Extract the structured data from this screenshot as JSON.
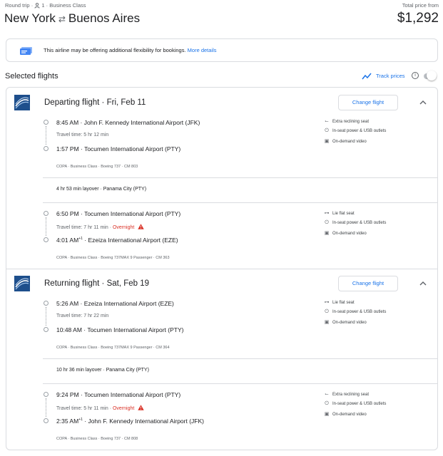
{
  "header": {
    "trip_type": "Round trip",
    "passengers": "1",
    "cabin": "Business Class",
    "origin": "New York",
    "destination": "Buenos Aires",
    "price_label": "Total price from",
    "price": "$1,292"
  },
  "banner": {
    "icon": "ticket-icon",
    "text": "This airline may be offering additional flexibility for bookings.",
    "link": "More details"
  },
  "selected": {
    "title": "Selected flights",
    "track_prices": "Track prices",
    "track_enabled": false
  },
  "departing": {
    "title": "Departing flight",
    "date": "Fri, Feb 11",
    "change": "Change flight",
    "segments": [
      {
        "dep_time": "8:45 AM",
        "dep_airport": "John F. Kennedy International Airport (JFK)",
        "travel": "Travel time: 5 hr 12 min",
        "overnight": "",
        "arr_time": "1:57 PM",
        "arr_sup": "",
        "arr_airport": "Tocumen International Airport (PTY)",
        "details": "COPA · Business Class · Boeing 737 · CM 803",
        "amenities": [
          "Extra reclining seat",
          "In-seat power & USB outlets",
          "On-demand video"
        ]
      },
      {
        "dep_time": "6:50 PM",
        "dep_airport": "Tocumen International Airport (PTY)",
        "travel": "Travel time: 7 hr 11 min",
        "overnight": "Overnight",
        "arr_time": "4:01 AM",
        "arr_sup": "+1",
        "arr_airport": "Ezeiza International Airport (EZE)",
        "details": "COPA · Business Class · Boeing 737MAX 9 Passenger · CM 363",
        "amenities": [
          "Lie flat seat",
          "In-seat power & USB outlets",
          "On-demand video"
        ]
      }
    ],
    "layover": "4 hr 53 min layover · Panama City (PTY)"
  },
  "returning": {
    "title": "Returning flight",
    "date": "Sat, Feb 19",
    "change": "Change flight",
    "segments": [
      {
        "dep_time": "5:26 AM",
        "dep_airport": "Ezeiza International Airport (EZE)",
        "travel": "Travel time: 7 hr 22 min",
        "overnight": "",
        "arr_time": "10:48 AM",
        "arr_sup": "",
        "arr_airport": "Tocumen International Airport (PTY)",
        "details": "COPA · Business Class · Boeing 737MAX 9 Passenger · CM 364",
        "amenities": [
          "Lie flat seat",
          "In-seat power & USB outlets",
          "On-demand video"
        ]
      },
      {
        "dep_time": "9:24 PM",
        "dep_airport": "Tocumen International Airport (PTY)",
        "travel": "Travel time: 5 hr 11 min",
        "overnight": "Overnight",
        "arr_time": "2:35 AM",
        "arr_sup": "+1",
        "arr_airport": "John F. Kennedy International Airport (JFK)",
        "details": "COPA · Business Class · Boeing 737 · CM 808",
        "amenities": [
          "Extra reclining seat",
          "In-seat power & USB outlets",
          "On-demand video"
        ]
      }
    ],
    "layover": "10 hr 36 min layover · Panama City (PTY)"
  },
  "icons": {
    "extra_reclining": "recline-seat-icon",
    "lie_flat": "lie-flat-icon",
    "power": "power-plug-icon",
    "video": "video-icon",
    "overnight": "warning-icon"
  },
  "colors": {
    "link": "#1a73e8",
    "warning": "#d93025",
    "airline": "#1e4f8c"
  }
}
